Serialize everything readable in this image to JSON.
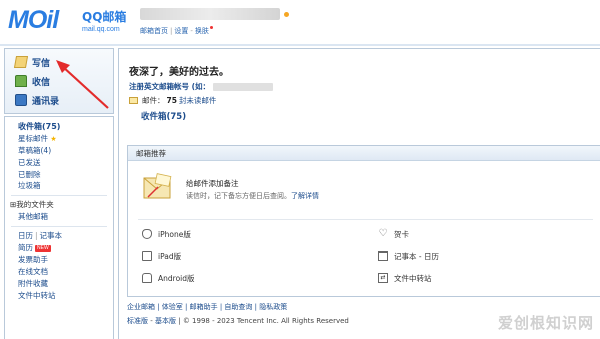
{
  "header": {
    "brand_name": "QQ邮箱",
    "brand_domain": "mail.qq.com",
    "logo_text": "MOil",
    "links": [
      "邮箱首页",
      "设置",
      "换肤"
    ],
    "separators": [
      "|",
      "-"
    ]
  },
  "sidebar": {
    "actions": [
      {
        "label": "写信",
        "icon": "write-icon"
      },
      {
        "label": "收信",
        "icon": "inbox-icon"
      },
      {
        "label": "通讯录",
        "icon": "contacts-icon"
      }
    ],
    "folders": [
      {
        "label": "收件箱(75)",
        "bold": true
      },
      {
        "label": "星标邮件"
      },
      {
        "label": "草稿箱(4)"
      },
      {
        "label": "已发送"
      },
      {
        "label": "已删除"
      },
      {
        "label": "垃圾箱"
      }
    ],
    "my_folders": {
      "label": "⊞我的文件夹",
      "other": "其他邮箱"
    },
    "tools": [
      {
        "label": "日历",
        "label2": "记事本"
      },
      {
        "label": "简历",
        "badge": "NEW"
      },
      {
        "label": "发票助手"
      },
      {
        "label": "在线文档"
      },
      {
        "label": "附件收藏"
      },
      {
        "label": "文件中转站"
      }
    ]
  },
  "main": {
    "greeting": "夜深了，美好的过去。",
    "register_line": "注册英文邮箱帐号 (如：",
    "mail_info": {
      "prefix": "邮件：",
      "count": "75",
      "suffix": "封未读邮件"
    },
    "inbox_link": "收件箱(75)",
    "recommend": {
      "title": "邮箱推荐",
      "note_title": "给邮件添加备注",
      "note_desc": "读信时，记下备忘方便日后查阅。",
      "note_link": "了解详情",
      "items_left": [
        "iPhone版",
        "iPad版",
        "Android版"
      ],
      "items_right": [
        "贺卡",
        "记事本 - 日历",
        "文件中转站"
      ]
    },
    "footer_links": "企业邮箱 | 体验室 | 邮箱助手 | 自助查询 | 隐私政策",
    "footer_version": {
      "standard": "标准版",
      "dash": "-",
      "basic": "基本版",
      "copyright": "| © 1998 - 2023 Tencent Inc. All Rights Reserved"
    }
  },
  "watermark": "爱创根知识网",
  "colors": {
    "accent": "#2a7de1",
    "link": "#1c4c8c",
    "border": "#b9c9da"
  }
}
